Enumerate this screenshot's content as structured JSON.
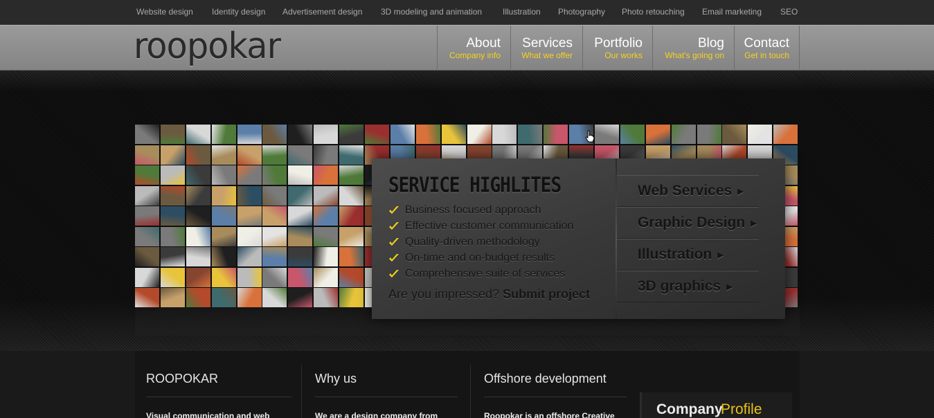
{
  "top_links": [
    "Website design",
    "Identity design",
    "Advertisement design",
    "3D modeling and animation",
    "Illustration",
    "Photography",
    "Photo retouching",
    "Email marketing",
    "SEO"
  ],
  "logo": "roopokar",
  "nav": [
    {
      "label": "About",
      "sub": "Company info"
    },
    {
      "label": "Services",
      "sub": "What we offer"
    },
    {
      "label": "Portfolio",
      "sub": "Our works"
    },
    {
      "label": "Blog",
      "sub": "What's going on"
    },
    {
      "label": "Contact",
      "sub": "Get in touch"
    }
  ],
  "highlights": {
    "title": "SERVICE HIGHLITES",
    "items": [
      "Business focused approach",
      "Effective customer communication",
      "Quality-driven methodology",
      "On-time and on-budget results",
      "Comprehensive suite of services"
    ],
    "impress_text": "Are you impressed?",
    "impress_link": "Submit project"
  },
  "services": [
    {
      "label": "Web Services"
    },
    {
      "label": "Graphic Design"
    },
    {
      "label": "Illustration"
    },
    {
      "label": "3D graphics"
    }
  ],
  "footer": {
    "col1": {
      "title": "ROOPOKAR",
      "text": "Visual communication and web"
    },
    "col2": {
      "title": "Why us",
      "text": "We are a design company from"
    },
    "col3": {
      "title": "Offshore development",
      "text": "Roopokar is an offshore Creative"
    },
    "profile_a": "Company",
    "profile_b": "Profile"
  },
  "colors": {
    "accent": "#f7d21d",
    "check": "#f2d21b",
    "header_bg": "#8f8f8f"
  },
  "icons": {
    "check": "check-icon",
    "arrow": "arrow-right-icon",
    "cursor": "hand-cursor-icon"
  }
}
